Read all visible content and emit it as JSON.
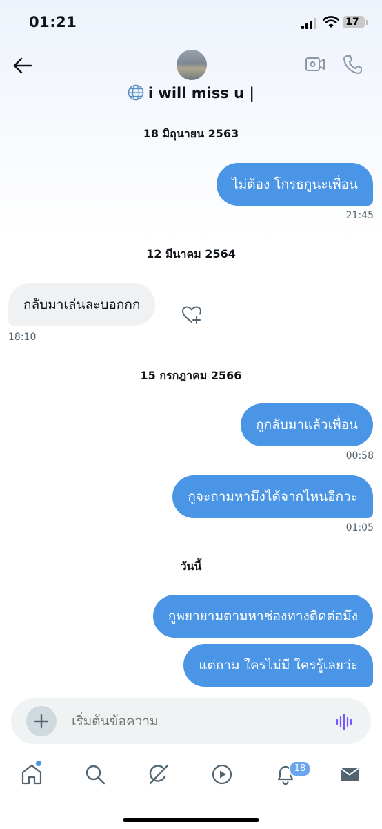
{
  "status_bar": {
    "time": "01:21",
    "battery": "17"
  },
  "header": {
    "title": "i will miss u |",
    "title_icon": "globe-icon",
    "back_icon": "arrow-left-icon",
    "video_icon": "video-call-icon",
    "phone_icon": "phone-icon"
  },
  "conversation": {
    "date_1": "18 มิถุนายน 2563",
    "msg_1": "ไม่ต้อง โกรธกูนะเพื่อน",
    "time_1": "21:45",
    "date_2": "12 มีนาคม 2564",
    "msg_2": "กลับมาเล่นละบอกกก",
    "time_2": "18:10",
    "date_3": "15 กรกฎาคม 2566",
    "msg_3": "กูกลับมาแล้วเพื่อน",
    "time_3": "00:58",
    "msg_4": "กูจะถามหามึงได้จากไหนอีกวะ",
    "time_4": "01:05",
    "date_4": "วันนี้",
    "msg_5": "กูพยายามตามหาช่องทางติดต่อมึง",
    "msg_6": "แต่ถาม ใครไม่มี ใครรู้เลยว่ะ"
  },
  "composer": {
    "placeholder": "เริ่มต้นข้อความ"
  },
  "bottom_nav": {
    "items": [
      "home-icon",
      "search-icon",
      "grok-icon",
      "video-icon",
      "notifications-icon",
      "messages-icon"
    ],
    "notification_count": "18"
  },
  "colors": {
    "outgoing_bubble": "#4a95e6",
    "incoming_bubble": "#eff1f3",
    "accent_voice": "#7856ff"
  }
}
